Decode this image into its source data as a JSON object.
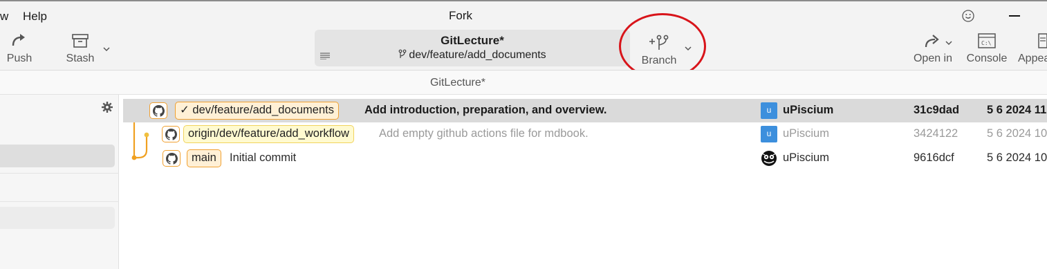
{
  "window": {
    "title": "Fork"
  },
  "menu": {
    "view_partial": "w",
    "help": "Help"
  },
  "toolbar": {
    "push_label": "Push",
    "stash_label": "Stash",
    "branch_label": "Branch",
    "open_in_label": "Open in",
    "console_label": "Console",
    "appearance_partial": "Appea"
  },
  "repo": {
    "name": "GitLecture*",
    "branch": "dev/feature/add_documents"
  },
  "tab": {
    "title": "GitLecture*"
  },
  "commits": [
    {
      "ref": "dev/feature/add_documents",
      "ref_check": "✓",
      "ref_type": "local",
      "message": "Add introduction, preparation, and overview.",
      "avatar_letter": "u",
      "author": "uPiscium",
      "hash": "31c9dad",
      "date": "5 6 2024 11",
      "selected": true
    },
    {
      "ref": "origin/dev/feature/add_workflow",
      "ref_type": "remote",
      "message": "Add empty github actions file for mdbook.",
      "avatar_letter": "u",
      "author": "uPiscium",
      "hash": "3424122",
      "date": "5 6 2024 10"
    },
    {
      "ref": "main",
      "ref_type": "local",
      "message": "Initial commit",
      "author": "uPiscium",
      "hash": "9616dcf",
      "date": "5 6 2024 10"
    }
  ],
  "colors": {
    "graph_line": "#f0a020",
    "annotation_circle": "#d8141a",
    "avatar_blue": "#3c8fdd"
  },
  "icons": [
    "push-icon",
    "stash-icon",
    "branch-icon",
    "open-in-icon",
    "console-icon",
    "appearance-icon",
    "smiley-icon",
    "gear-icon",
    "github-icon"
  ]
}
